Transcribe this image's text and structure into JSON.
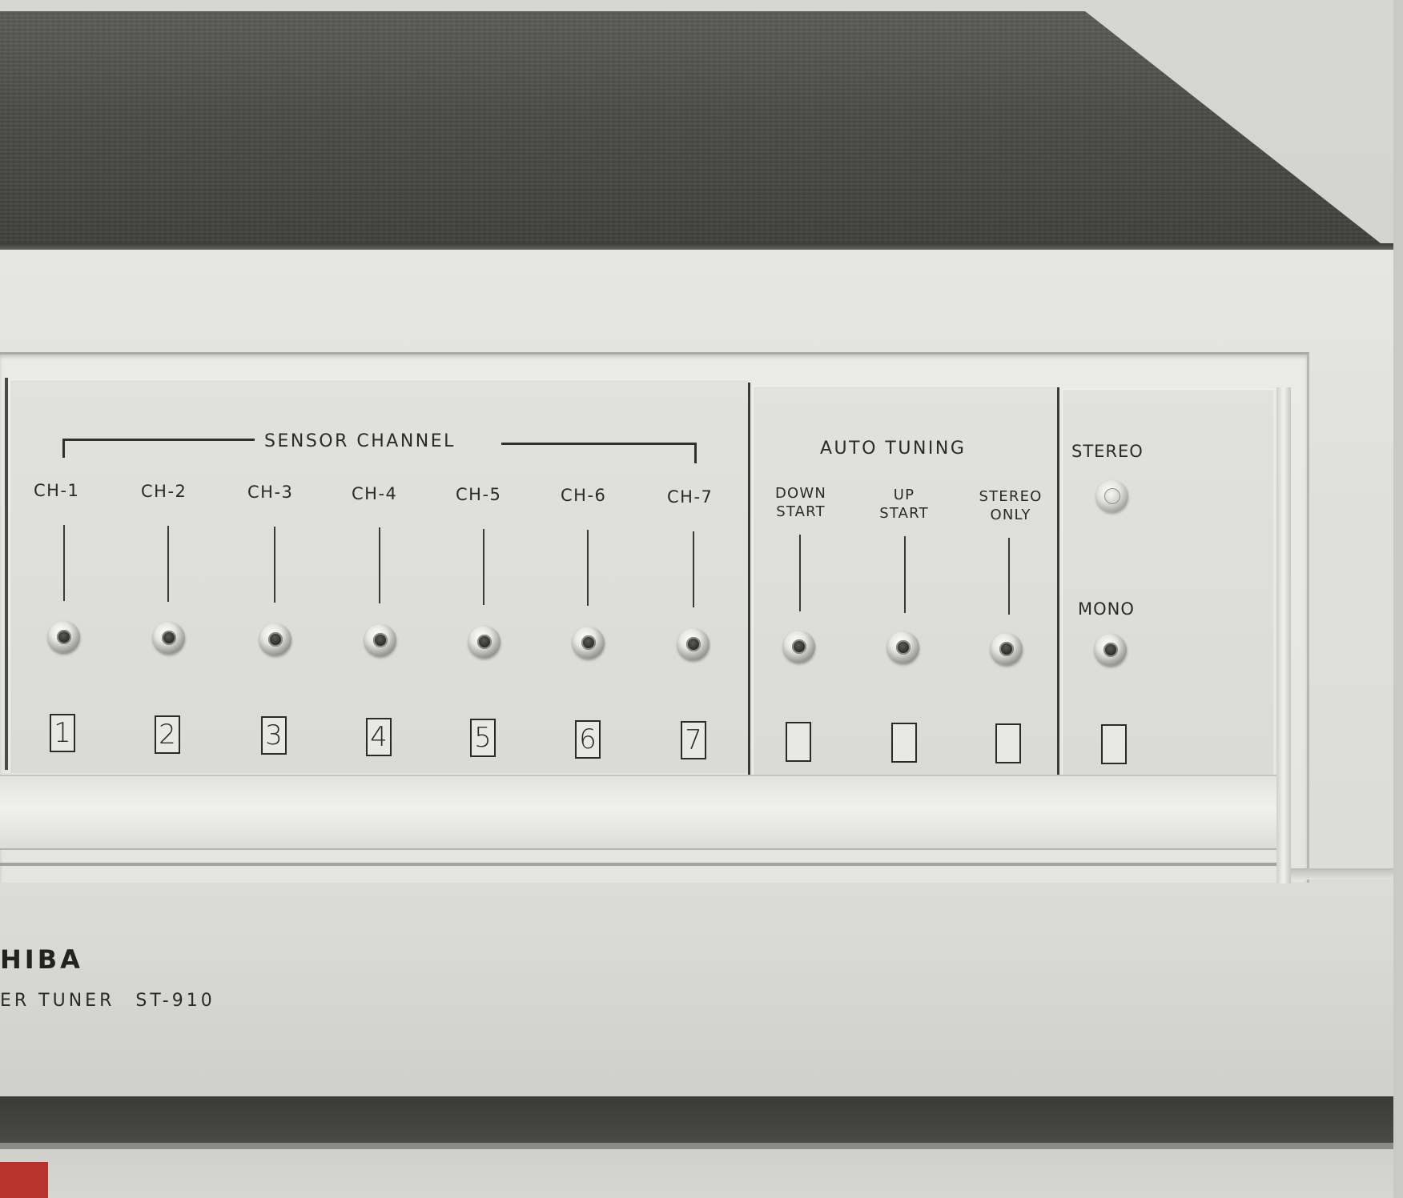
{
  "photo": {
    "brand_fragment": "HIBA",
    "model_fragment": "ER TUNER",
    "model_number": "ST-910"
  },
  "sensor_channel": {
    "section_label": "SENSOR CHANNEL",
    "channels": [
      {
        "label": "CH-1",
        "number": "1"
      },
      {
        "label": "CH-2",
        "number": "2"
      },
      {
        "label": "CH-3",
        "number": "3"
      },
      {
        "label": "CH-4",
        "number": "4"
      },
      {
        "label": "CH-5",
        "number": "5"
      },
      {
        "label": "CH-6",
        "number": "6"
      },
      {
        "label": "CH-7",
        "number": "7"
      }
    ]
  },
  "auto_tuning": {
    "section_label": "AUTO TUNING",
    "controls": [
      {
        "line1": "DOWN",
        "line2": "START"
      },
      {
        "line1": "UP",
        "line2": "START"
      },
      {
        "line1": "STEREO",
        "line2": "ONLY"
      }
    ]
  },
  "mode": {
    "stereo_label": "STEREO",
    "mono_label": "MONO"
  },
  "colors": {
    "faceplate": "#dfdfdc",
    "wood": "#4c4c4a",
    "text": "#2a2a28"
  }
}
